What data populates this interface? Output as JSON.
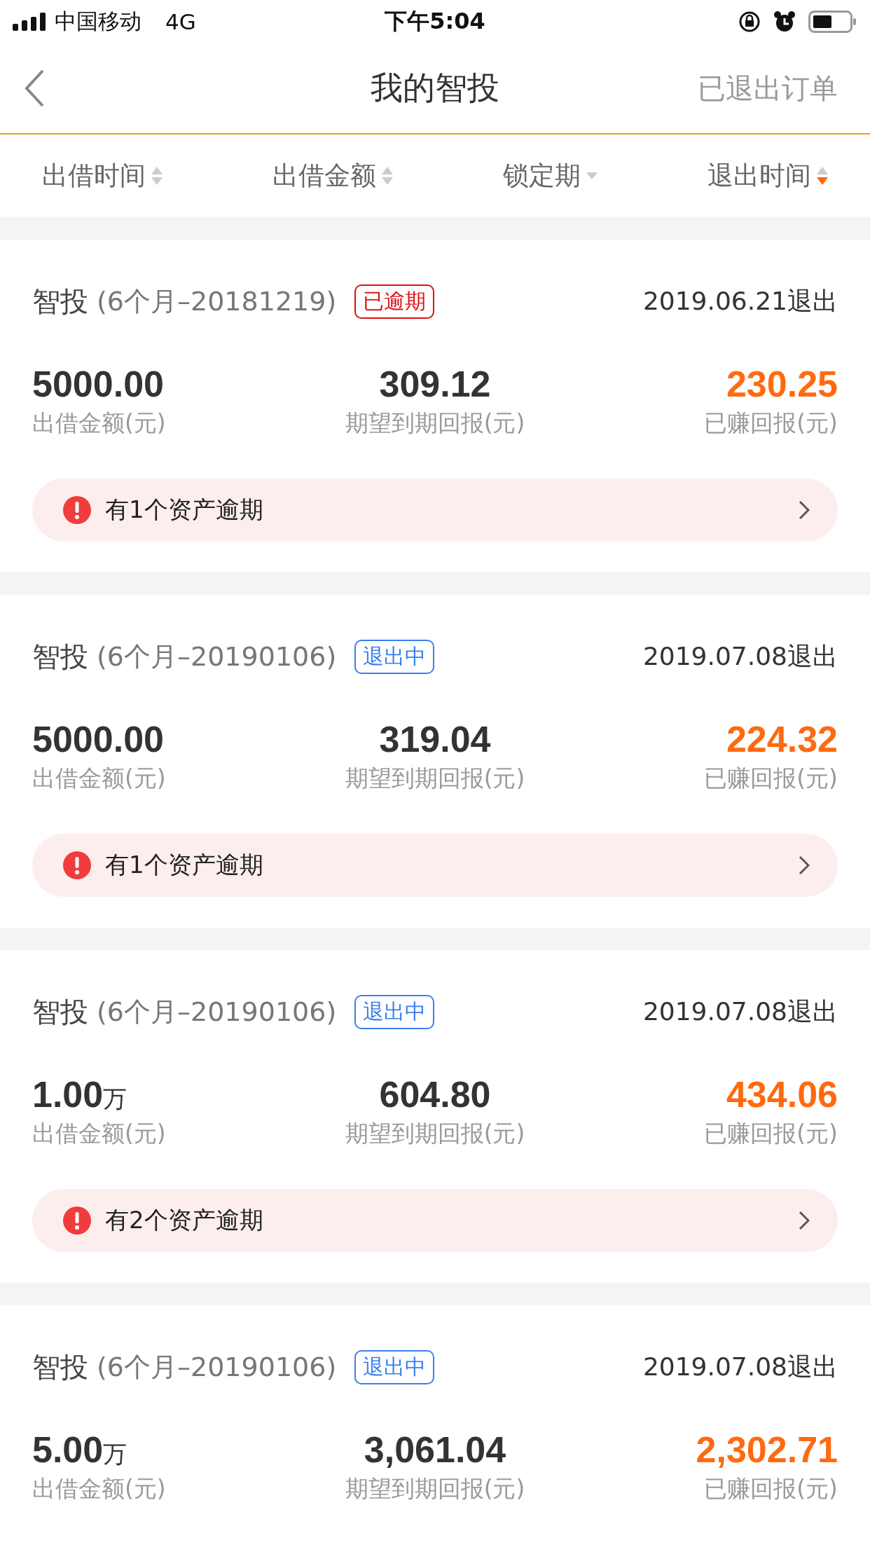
{
  "status_bar": {
    "carrier": "中国移动",
    "network": "4G",
    "time": "下午5:04"
  },
  "nav": {
    "title": "我的智投",
    "action": "已退出订单"
  },
  "sort_bar": [
    {
      "label": "出借时间",
      "kind": "updown",
      "descending": false
    },
    {
      "label": "出借金额",
      "kind": "updown",
      "descending": false
    },
    {
      "label": "锁定期",
      "kind": "down",
      "descending": false
    },
    {
      "label": "退出时间",
      "kind": "updown",
      "descending": true
    }
  ],
  "orders": [
    {
      "name": "智投",
      "term": "(6个月–20181219)",
      "badge": {
        "text": "已逾期",
        "kind": "overdue"
      },
      "exit": "2019.06.21退出",
      "amount": "5000.00",
      "amount_label": "出借金额(元)",
      "expected": "309.12",
      "expected_label": "期望到期回报(元)",
      "earned": "230.25",
      "earned_label": "已赚回报(元)",
      "alert": "有1个资产逾期"
    },
    {
      "name": "智投",
      "term": "(6个月–20190106)",
      "badge": {
        "text": "退出中",
        "kind": "exiting"
      },
      "exit": "2019.07.08退出",
      "amount": "5000.00",
      "amount_label": "出借金额(元)",
      "expected": "319.04",
      "expected_label": "期望到期回报(元)",
      "earned": "224.32",
      "earned_label": "已赚回报(元)",
      "alert": "有1个资产逾期"
    },
    {
      "name": "智投",
      "term": "(6个月–20190106)",
      "badge": {
        "text": "退出中",
        "kind": "exiting"
      },
      "exit": "2019.07.08退出",
      "amount": "1.00",
      "amount_unit": "万",
      "amount_label": "出借金额(元)",
      "expected": "604.80",
      "expected_label": "期望到期回报(元)",
      "earned": "434.06",
      "earned_label": "已赚回报(元)",
      "alert": "有2个资产逾期"
    },
    {
      "name": "智投",
      "term": "(6个月–20190106)",
      "badge": {
        "text": "退出中",
        "kind": "exiting"
      },
      "exit": "2019.07.08退出",
      "amount": "5.00",
      "amount_unit": "万",
      "amount_label": "出借金额(元)",
      "expected": "3,061.04",
      "expected_label": "期望到期回报(元)",
      "earned": "2,302.71",
      "earned_label": "已赚回报(元)"
    }
  ]
}
